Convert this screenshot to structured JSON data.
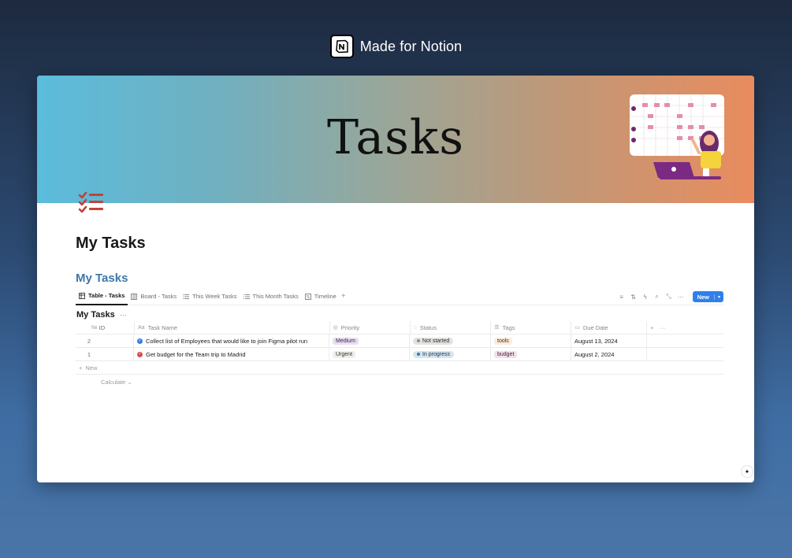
{
  "brand": {
    "text": "Made for Notion",
    "logo_icon": "notion-logo-icon"
  },
  "cover": {
    "title": "Tasks",
    "gradient": [
      "#5bbcdc",
      "#9ba698",
      "#e98c5e"
    ]
  },
  "page": {
    "title": "My Tasks",
    "icon": "checklist-icon"
  },
  "database": {
    "title": "My Tasks",
    "views": [
      {
        "label": "Table - Tasks",
        "icon": "table-icon",
        "active": true
      },
      {
        "label": "Board - Tasks",
        "icon": "board-icon",
        "active": false
      },
      {
        "label": "This Week Tasks",
        "icon": "list-icon",
        "active": false
      },
      {
        "label": "This Month Tasks",
        "icon": "list-icon",
        "active": false
      },
      {
        "label": "Timeline",
        "icon": "timeline-icon",
        "active": false
      }
    ],
    "new_label": "New",
    "accent": "#2f80ed"
  },
  "table": {
    "title": "My Tasks",
    "columns": {
      "id": "ID",
      "id_prefix": "№",
      "name": "Task Name",
      "name_prefix": "Aa",
      "priority": "Priority",
      "status": "Status",
      "tags": "Tags",
      "due": "Due Date"
    },
    "rows": [
      {
        "id": "2",
        "name": "Collect list of Employees that would like to join Figma pilot run",
        "check_color": "#2f80ed",
        "priority": "Medium",
        "status": "Not started",
        "tag": "tools",
        "due": "August 13, 2024"
      },
      {
        "id": "1",
        "name": "Get budget for the Team trip to Madrid",
        "check_color": "#d44c47",
        "priority": "Urgent",
        "status": "In progress",
        "tag": "budget",
        "due": "August 2, 2024"
      }
    ],
    "new_row_label": "New",
    "calculate_label": "Calculate"
  }
}
